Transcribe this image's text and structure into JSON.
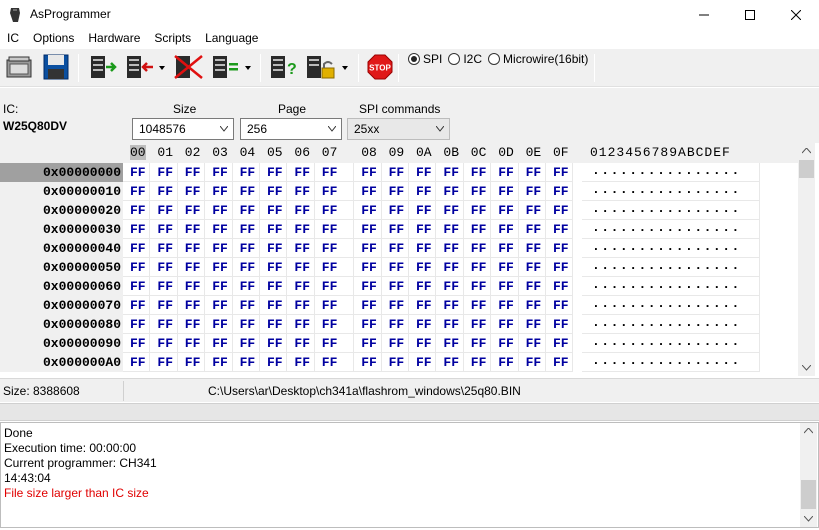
{
  "window": {
    "title": "AsProgrammer"
  },
  "menu": [
    "IC",
    "Options",
    "Hardware",
    "Scripts",
    "Language"
  ],
  "toolbar": {
    "protocols": [
      {
        "label": "SPI",
        "selected": true
      },
      {
        "label": "I2C",
        "selected": false
      },
      {
        "label": "Microwire(16bit)",
        "selected": false
      }
    ],
    "icons": [
      "open-icon",
      "save-icon",
      "read-icon",
      "write-icon",
      "erase-icon",
      "verify-icon",
      "blank-check-icon",
      "unlock-icon",
      "stop-icon"
    ],
    "stop_label": "STOP"
  },
  "params": {
    "ic_label": "IC:",
    "ic_name": "W25Q80DV",
    "size_label": "Size",
    "size_value": "1048576",
    "page_label": "Page",
    "page_value": "256",
    "spi_label": "SPI commands",
    "spi_value": "25xx"
  },
  "hex": {
    "header_cols": [
      "00",
      "01",
      "02",
      "03",
      "04",
      "05",
      "06",
      "07",
      "08",
      "09",
      "0A",
      "0B",
      "0C",
      "0D",
      "0E",
      "0F"
    ],
    "header_ascii": "0123456789ABCDEF",
    "rows": [
      {
        "addr": "0x00000000",
        "bytes": [
          "FF",
          "FF",
          "FF",
          "FF",
          "FF",
          "FF",
          "FF",
          "FF",
          "FF",
          "FF",
          "FF",
          "FF",
          "FF",
          "FF",
          "FF",
          "FF"
        ],
        "ascii": "................"
      },
      {
        "addr": "0x00000010",
        "bytes": [
          "FF",
          "FF",
          "FF",
          "FF",
          "FF",
          "FF",
          "FF",
          "FF",
          "FF",
          "FF",
          "FF",
          "FF",
          "FF",
          "FF",
          "FF",
          "FF"
        ],
        "ascii": "................"
      },
      {
        "addr": "0x00000020",
        "bytes": [
          "FF",
          "FF",
          "FF",
          "FF",
          "FF",
          "FF",
          "FF",
          "FF",
          "FF",
          "FF",
          "FF",
          "FF",
          "FF",
          "FF",
          "FF",
          "FF"
        ],
        "ascii": "................"
      },
      {
        "addr": "0x00000030",
        "bytes": [
          "FF",
          "FF",
          "FF",
          "FF",
          "FF",
          "FF",
          "FF",
          "FF",
          "FF",
          "FF",
          "FF",
          "FF",
          "FF",
          "FF",
          "FF",
          "FF"
        ],
        "ascii": "................"
      },
      {
        "addr": "0x00000040",
        "bytes": [
          "FF",
          "FF",
          "FF",
          "FF",
          "FF",
          "FF",
          "FF",
          "FF",
          "FF",
          "FF",
          "FF",
          "FF",
          "FF",
          "FF",
          "FF",
          "FF"
        ],
        "ascii": "................"
      },
      {
        "addr": "0x00000050",
        "bytes": [
          "FF",
          "FF",
          "FF",
          "FF",
          "FF",
          "FF",
          "FF",
          "FF",
          "FF",
          "FF",
          "FF",
          "FF",
          "FF",
          "FF",
          "FF",
          "FF"
        ],
        "ascii": "................"
      },
      {
        "addr": "0x00000060",
        "bytes": [
          "FF",
          "FF",
          "FF",
          "FF",
          "FF",
          "FF",
          "FF",
          "FF",
          "FF",
          "FF",
          "FF",
          "FF",
          "FF",
          "FF",
          "FF",
          "FF"
        ],
        "ascii": "................"
      },
      {
        "addr": "0x00000070",
        "bytes": [
          "FF",
          "FF",
          "FF",
          "FF",
          "FF",
          "FF",
          "FF",
          "FF",
          "FF",
          "FF",
          "FF",
          "FF",
          "FF",
          "FF",
          "FF",
          "FF"
        ],
        "ascii": "................"
      },
      {
        "addr": "0x00000080",
        "bytes": [
          "FF",
          "FF",
          "FF",
          "FF",
          "FF",
          "FF",
          "FF",
          "FF",
          "FF",
          "FF",
          "FF",
          "FF",
          "FF",
          "FF",
          "FF",
          "FF"
        ],
        "ascii": "................"
      },
      {
        "addr": "0x00000090",
        "bytes": [
          "FF",
          "FF",
          "FF",
          "FF",
          "FF",
          "FF",
          "FF",
          "FF",
          "FF",
          "FF",
          "FF",
          "FF",
          "FF",
          "FF",
          "FF",
          "FF"
        ],
        "ascii": "................"
      },
      {
        "addr": "0x000000A0",
        "bytes": [
          "FF",
          "FF",
          "FF",
          "FF",
          "FF",
          "FF",
          "FF",
          "FF",
          "FF",
          "FF",
          "FF",
          "FF",
          "FF",
          "FF",
          "FF",
          "FF"
        ],
        "ascii": "................"
      }
    ]
  },
  "status": {
    "size": "Size: 8388608",
    "file_path": "C:\\Users\\ar\\Desktop\\ch341a\\flashrom_windows\\25q80.BIN"
  },
  "log": [
    {
      "text": "Done",
      "error": false
    },
    {
      "text": "Execution time: 00:00:00",
      "error": false
    },
    {
      "text": "Current programmer: CH341",
      "error": false
    },
    {
      "text": "14:43:04",
      "error": false
    },
    {
      "text": "File size larger than IC size",
      "error": true
    }
  ],
  "colors": {
    "hex_text": "#0000a0",
    "error_text": "#e00000",
    "selected_addr": "#a0a0a0"
  }
}
